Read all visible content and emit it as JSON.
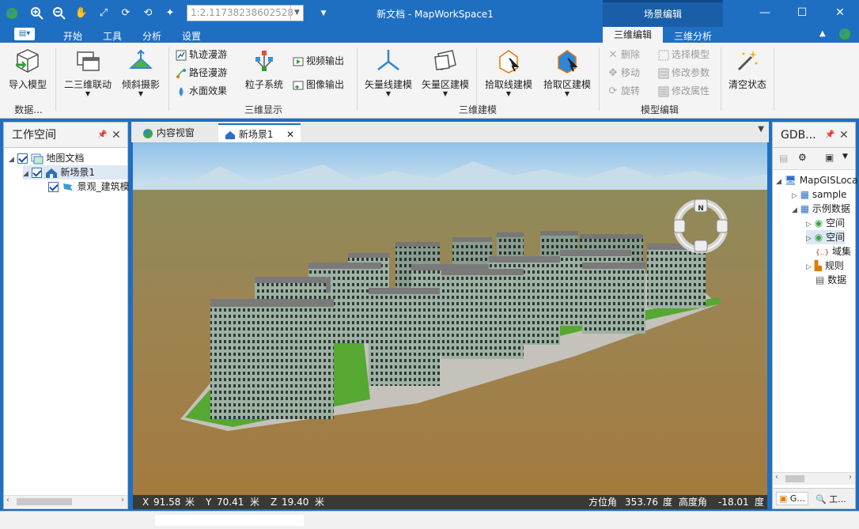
{
  "app": {
    "window_title": "新文档 - MapWorkSpace1",
    "scale_value": "1:2.11738238602528",
    "context_group": "场景编辑"
  },
  "colors": {
    "brand": "#1e6fc2",
    "ribbon": "#f4f4f4",
    "accent_dark": "#1a5ea8"
  },
  "menu": {
    "tabs": [
      "开始",
      "工具",
      "分析",
      "设置"
    ],
    "context_tabs": [
      "三维编辑",
      "三维分析"
    ]
  },
  "ribbon": {
    "import_model": "导入模型",
    "group_data": "数据...",
    "link_2d3d": "二三维联动",
    "oblique": "倾斜摄影",
    "track_roam": "轨迹漫游",
    "path_roam": "路径漫游",
    "water_effect": "水面效果",
    "particle": "粒子系统",
    "video_out": "视频输出",
    "image_out": "图像输出",
    "group_display": "三维显示",
    "vector_line_build": "矢量线建模",
    "vector_area_build": "矢量区建模",
    "pick_line_build": "拾取线建模",
    "pick_area_build": "拾取区建模",
    "group_build": "三维建模",
    "delete": "删除",
    "move": "移动",
    "rotate": "旋转",
    "select_model": "选择模型",
    "modify_params": "修改参数",
    "modify_attrs": "修改属性",
    "group_edit": "模型编辑",
    "clear_state": "清空状态"
  },
  "left_panel": {
    "title": "工作空间",
    "tree": [
      "地图文档",
      "新场景1",
      "景观_建筑模"
    ]
  },
  "view_tabs": [
    "内容视窗",
    "新场景1"
  ],
  "right_panel": {
    "title": "GDB...",
    "tree": [
      "MapGISLoca",
      "sample",
      "示例数据",
      "空间",
      "空间",
      "域集",
      "规则",
      "数据"
    ],
    "bottom_tabs": [
      "G...",
      "工..."
    ]
  },
  "status3d": {
    "x_label": "X",
    "x_value": "91.58",
    "x_unit": "米",
    "y_label": "Y",
    "y_value": "70.41",
    "y_unit": "米",
    "z_label": "Z",
    "z_value": "19.40",
    "z_unit": "米",
    "azimuth_label": "方位角",
    "azimuth_value": "353.76",
    "azimuth_unit": "度",
    "elevation_label": "高度角",
    "elevation_value": "-18.01",
    "elevation_unit": "度"
  },
  "compass": {
    "north_label": "N"
  }
}
